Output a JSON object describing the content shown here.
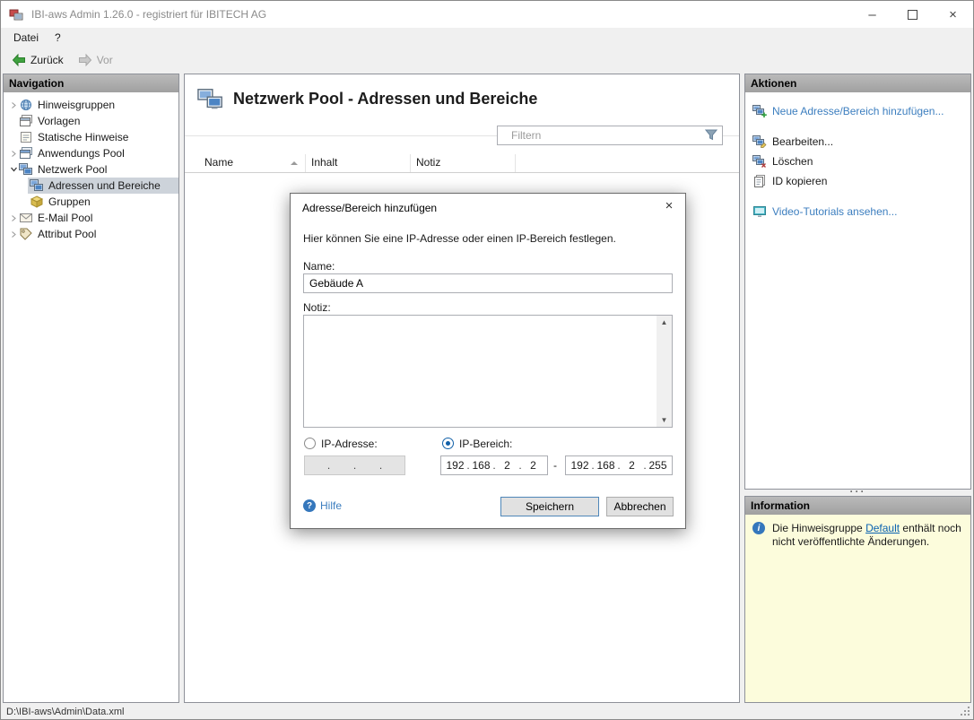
{
  "colors": {
    "accent_link": "#3C7EBF",
    "info_link": "#0A62B0",
    "selected_nav_bg": "#CDD3DA",
    "panel_header_gray": "#A9A9A9",
    "info_panel_bg": "#FCFCDC",
    "radio_selected": "#1160A8",
    "back_arrow_green": "#3FA23F"
  },
  "window": {
    "title": "IBI-aws Admin 1.26.0 - registriert für IBITECH AG",
    "controls": {
      "minimize": "–",
      "close": "×"
    }
  },
  "menu": {
    "items": [
      {
        "label": "Datei"
      },
      {
        "label": "?"
      }
    ]
  },
  "toolbar": {
    "back": "Zurück",
    "forward": "Vor"
  },
  "navigation": {
    "header": "Navigation",
    "items": [
      {
        "label": "Hinweisgruppen",
        "icon": "hint-groups-icon",
        "state": "collapsed",
        "level": 0
      },
      {
        "label": "Vorlagen",
        "icon": "templates-icon",
        "state": "leaf",
        "level": 0
      },
      {
        "label": "Statische Hinweise",
        "icon": "static-hints-icon",
        "state": "leaf",
        "level": 0
      },
      {
        "label": "Anwendungs Pool",
        "icon": "application-pool-icon",
        "state": "collapsed",
        "level": 0
      },
      {
        "label": "Netzwerk Pool",
        "icon": "network-pool-icon",
        "state": "expanded",
        "level": 0
      },
      {
        "label": "Adressen und Bereiche",
        "icon": "addresses-ranges-icon",
        "state": "leaf",
        "level": 1,
        "selected": true
      },
      {
        "label": "Gruppen",
        "icon": "groups-icon",
        "state": "leaf",
        "level": 1
      },
      {
        "label": "E-Mail Pool",
        "icon": "email-pool-icon",
        "state": "collapsed",
        "level": 0
      },
      {
        "label": "Attribut Pool",
        "icon": "attribute-pool-icon",
        "state": "collapsed",
        "level": 0
      }
    ]
  },
  "main": {
    "title": "Netzwerk Pool - Adressen und Bereiche",
    "filter_placeholder": "Filtern",
    "columns": [
      "Name",
      "Inhalt",
      "Notiz"
    ],
    "sort": {
      "column": "Name",
      "direction": "asc"
    }
  },
  "dialog": {
    "title": "Adresse/Bereich hinzufügen",
    "close_glyph": "×",
    "description": "Hier können Sie eine IP-Adresse oder einen IP-Bereich festlegen.",
    "name_label": "Name:",
    "name_value": "Gebäude A",
    "note_label": "Notiz:",
    "note_value": "",
    "radio_address_label": "IP-Adresse:",
    "radio_range_label": "IP-Bereich:",
    "radio_selected": "IP-Bereich",
    "ip_address_value": [
      "",
      "",
      "",
      ""
    ],
    "ip_range_from": [
      "192",
      "168",
      "2",
      "2"
    ],
    "range_separator": "-",
    "ip_range_to": [
      "192",
      "168",
      "2",
      "255"
    ],
    "help_label": "Hilfe",
    "save_label": "Speichern",
    "cancel_label": "Abbrechen"
  },
  "actions": {
    "header": "Aktionen",
    "items": [
      {
        "label": "Neue Adresse/Bereich hinzufügen...",
        "icon": "add-address-icon",
        "style": "link"
      },
      {
        "label": "Bearbeiten...",
        "icon": "edit-icon",
        "style": "default"
      },
      {
        "label": "Löschen",
        "icon": "delete-icon",
        "style": "default"
      },
      {
        "label": "ID kopieren",
        "icon": "copy-id-icon",
        "style": "default"
      },
      {
        "label": "Video-Tutorials ansehen...",
        "icon": "video-tutorials-icon",
        "style": "link"
      }
    ]
  },
  "information": {
    "header": "Information",
    "text_before": "Die Hinweisgruppe ",
    "link": "Default",
    "text_after": " enthält noch nicht veröffentlichte Änderungen."
  },
  "statusbar": {
    "path": "D:\\IBI-aws\\Admin\\Data.xml"
  }
}
